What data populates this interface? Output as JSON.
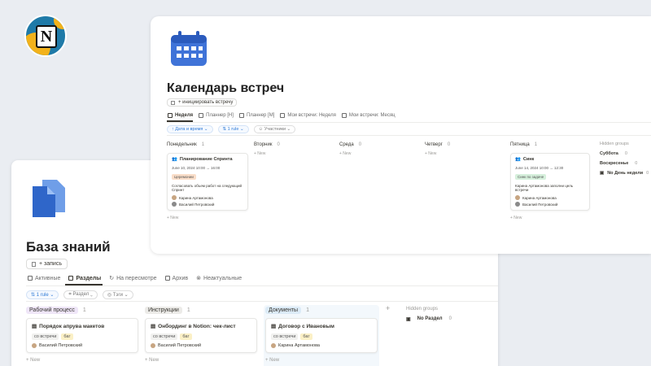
{
  "logo_letter": "N",
  "kb": {
    "title": "База знаний",
    "add_button": "+ запись",
    "tabs": [
      "Активные",
      "Разделы",
      "На пересмотре",
      "Архив",
      "Неактуальные"
    ],
    "filters": [
      "1 rule",
      "Раздел",
      "Тэги"
    ],
    "columns": [
      {
        "name": "Рабочий процесс",
        "count": "1",
        "color": "#efe6f8",
        "card": {
          "title": "Порядок апрува макетов",
          "tags": [
            "со встречи",
            "баг"
          ],
          "person": "Василий Петровский"
        }
      },
      {
        "name": "Инструкции",
        "count": "1",
        "color": "#ecebe8",
        "card": {
          "title": "Онбординг в Notion: чек-лист",
          "tags": [
            "со встречи",
            "баг"
          ],
          "person": "Василий Петровский"
        }
      },
      {
        "name": "Документы",
        "count": "1",
        "color": "#dcebf7",
        "card": {
          "title": "Договор с Ивановым",
          "tags": [
            "со встречи",
            "баг"
          ],
          "person": "Карина Артамонова"
        }
      }
    ],
    "new_label": "+ New",
    "add_group": "+",
    "hidden_groups": {
      "title": "Hidden groups",
      "items": [
        {
          "name": "No Раздел",
          "count": "0"
        }
      ]
    }
  },
  "cal": {
    "title": "Календарь встреч",
    "add_button": "+ инициировать встречу",
    "tabs": [
      "Неделя",
      "Планнер [Н]",
      "Планнер [М]",
      "Мои встречи: Неделя",
      "Мои встречи: Месяц"
    ],
    "filters": [
      "Дата и время",
      "1 rule",
      "Участники"
    ],
    "days": [
      {
        "name": "Понедельник",
        "count": "1"
      },
      {
        "name": "Вторник",
        "count": "0"
      },
      {
        "name": "Среда",
        "count": "0"
      },
      {
        "name": "Четверг",
        "count": "0"
      },
      {
        "name": "Пятница",
        "count": "1"
      }
    ],
    "mon_card": {
      "title": "Планирование Спринта",
      "date": "June 10, 2024 10:00 → 16:00",
      "tag": "Церемонии",
      "desc": "Согласовать объем работ на следующий Спринт",
      "people": [
        "Карина Артамонова",
        "Василий Петровский"
      ]
    },
    "fri_card": {
      "title": "Синк",
      "date": "June 14, 2024 10:00 → 12:30",
      "tag": "Синк по задаче",
      "desc": "Карина Артамонова заполни цель встречи",
      "people": [
        "Карина Артамонова",
        "Василий Петровский"
      ]
    },
    "new_label": "+ New",
    "hidden_groups": {
      "title": "Hidden groups",
      "items": [
        {
          "name": "Суббота",
          "count": "0"
        },
        {
          "name": "Воскресенье",
          "count": "0"
        },
        {
          "name": "No День недели",
          "count": "0"
        }
      ]
    }
  }
}
